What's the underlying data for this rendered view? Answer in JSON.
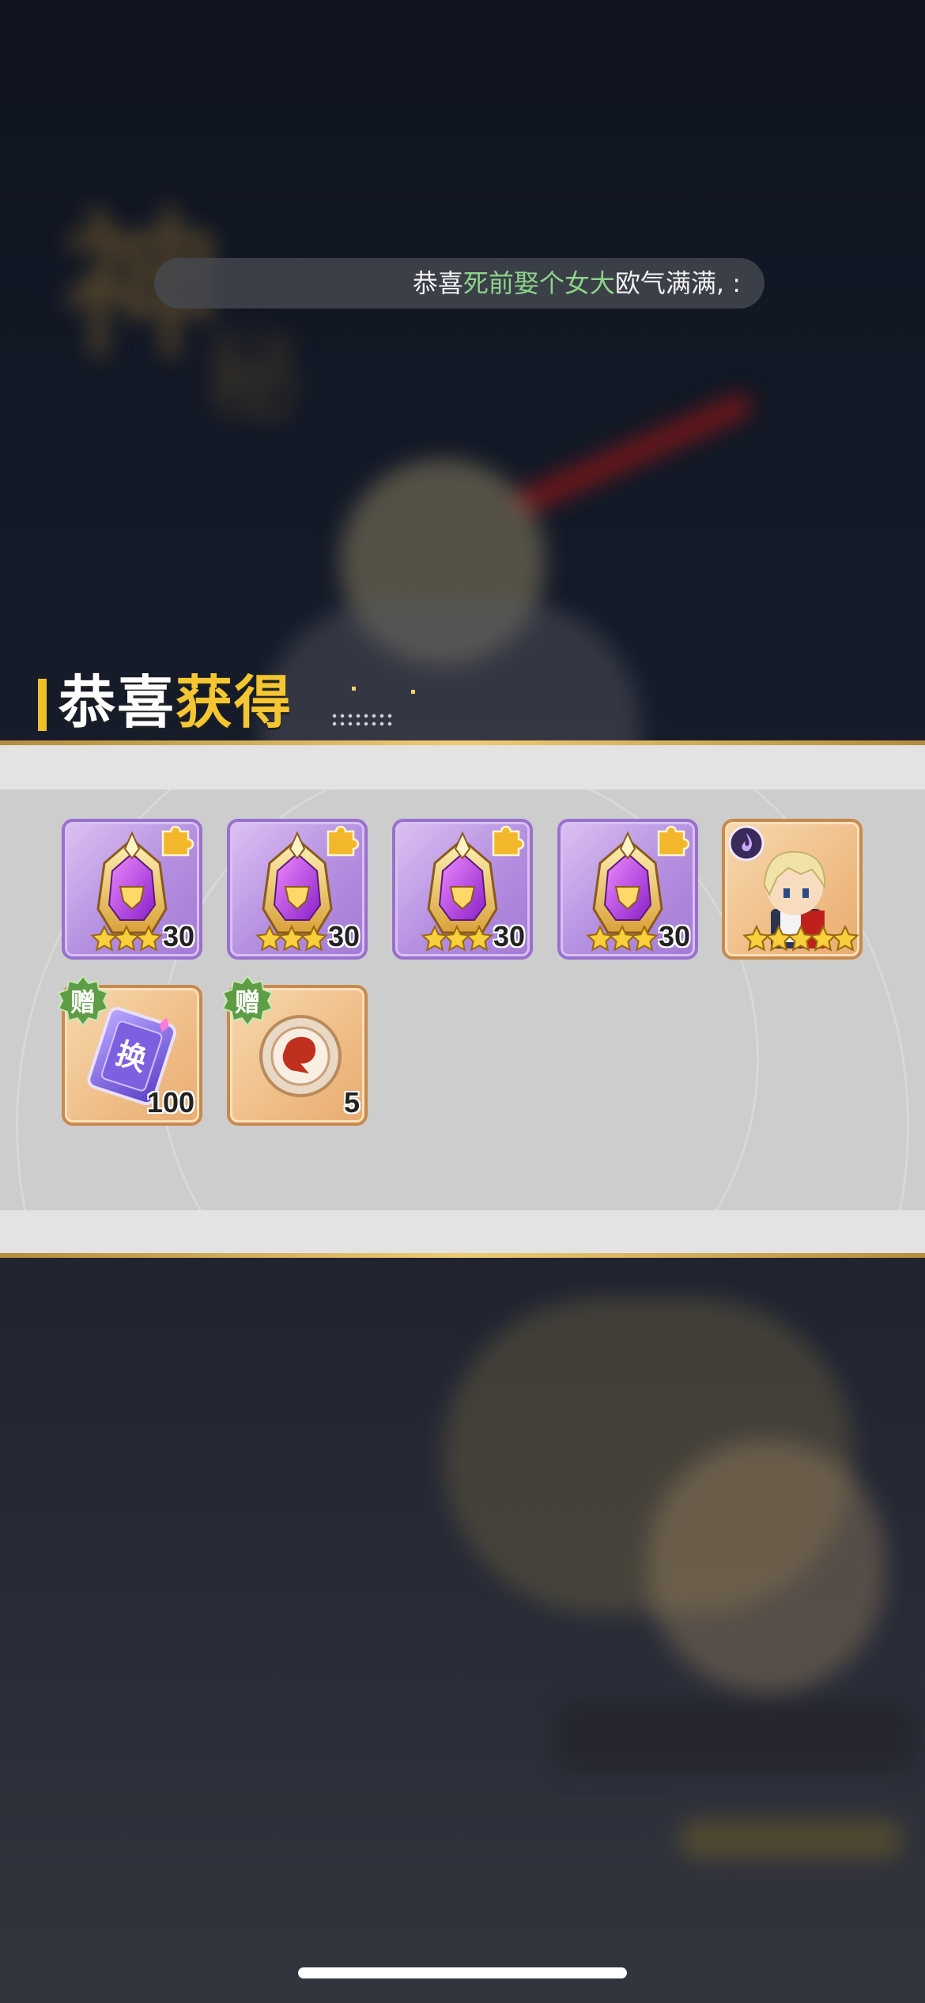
{
  "marquee": {
    "prefix": "恭喜",
    "player": "死前娶个女大",
    "suffix": "欧气满满, ",
    "tail": ":"
  },
  "title": {
    "part1": "恭喜",
    "part2": "获得"
  },
  "rewards": [
    {
      "name": "helmet-equipment",
      "count": "30",
      "stars": 3,
      "rarity": "purple"
    },
    {
      "name": "helmet-equipment",
      "count": "30",
      "stars": 3,
      "rarity": "purple"
    },
    {
      "name": "helmet-equipment",
      "count": "30",
      "stars": 3,
      "rarity": "purple"
    },
    {
      "name": "helmet-equipment",
      "count": "30",
      "stars": 3,
      "rarity": "purple"
    },
    {
      "name": "hero-portrait",
      "count": "",
      "stars": 5,
      "rarity": "orange"
    },
    {
      "name": "exchange-ticket",
      "count": "100",
      "badge": "赠",
      "rarity": "orange",
      "icon_label": "换"
    },
    {
      "name": "dragon-coin",
      "count": "5",
      "badge": "赠",
      "rarity": "orange"
    }
  ],
  "colors": {
    "accent_gold": "#f5c631",
    "highlight_green": "#8dd48a",
    "gift_green": "#6aa54a",
    "purple_frame": "#9a70cf",
    "orange_frame": "#c88a4b"
  }
}
